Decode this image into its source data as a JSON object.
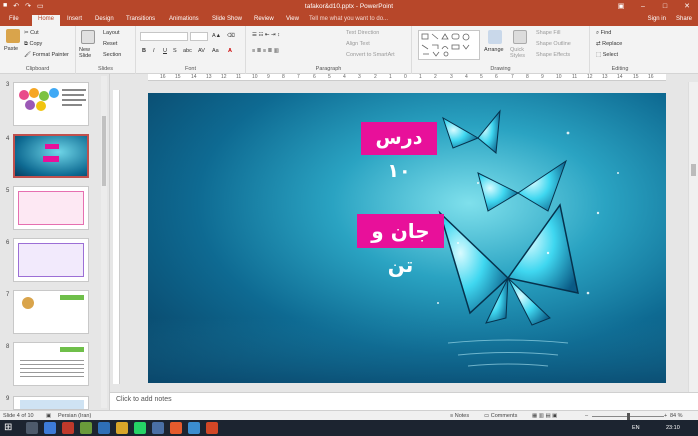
{
  "window": {
    "title": "tafakor&d10.pptx - PowerPoint"
  },
  "tabs": {
    "file": "File",
    "home": "Home",
    "insert": "Insert",
    "design": "Design",
    "transitions": "Transitions",
    "animations": "Animations",
    "slideshow": "Slide Show",
    "review": "Review",
    "view": "View",
    "tell": "Tell me what you want to do...",
    "signin": "Sign in",
    "share": "Share"
  },
  "ribbon": {
    "clipboard": {
      "label": "Clipboard",
      "paste": "Paste",
      "cut": "Cut",
      "copy": "Copy",
      "format_painter": "Format Painter"
    },
    "slides": {
      "label": "Slides",
      "new_slide": "New Slide",
      "layout": "Layout",
      "reset": "Reset",
      "section": "Section"
    },
    "font": {
      "label": "Font",
      "bold": "B",
      "italic": "I",
      "underline": "U",
      "strike": "S",
      "shadow": "abc",
      "spacing": "AV",
      "case": "Aa",
      "color": "A"
    },
    "paragraph": {
      "label": "Paragraph",
      "text_direction": "Text Direction",
      "align_text": "Align Text",
      "convert_smartart": "Convert to SmartArt"
    },
    "drawing": {
      "label": "Drawing",
      "arrange": "Arrange",
      "quick_styles": "Quick Styles",
      "shape_fill": "Shape Fill",
      "shape_outline": "Shape Outline",
      "shape_effects": "Shape Effects"
    },
    "editing": {
      "label": "Editing",
      "find": "Find",
      "replace": "Replace",
      "select": "Select"
    }
  },
  "ruler_ticks": [
    "16",
    "15",
    "14",
    "13",
    "12",
    "11",
    "10",
    "9",
    "8",
    "7",
    "6",
    "5",
    "4",
    "3",
    "2",
    "1",
    "0",
    "1",
    "2",
    "3",
    "4",
    "5",
    "6",
    "7",
    "8",
    "9",
    "10",
    "11",
    "12",
    "13",
    "14",
    "15",
    "16"
  ],
  "thumbnails": [
    {
      "num": "3"
    },
    {
      "num": "4"
    },
    {
      "num": "5"
    },
    {
      "num": "6"
    },
    {
      "num": "7"
    },
    {
      "num": "8"
    },
    {
      "num": "9"
    }
  ],
  "slide": {
    "lesson": "درس ۱۰",
    "topic": "جان و تن"
  },
  "notes_placeholder": "Click to add notes",
  "status": {
    "slide_of": "Slide 4 of 10",
    "language": "Persian (Iran)",
    "notes": "Notes",
    "comments": "Comments",
    "zoom": "84 %"
  },
  "taskbar": {
    "lang": "EN",
    "time": "23:10"
  },
  "colors": {
    "accent": "#b7472a",
    "label_bg": "#e8109a"
  }
}
